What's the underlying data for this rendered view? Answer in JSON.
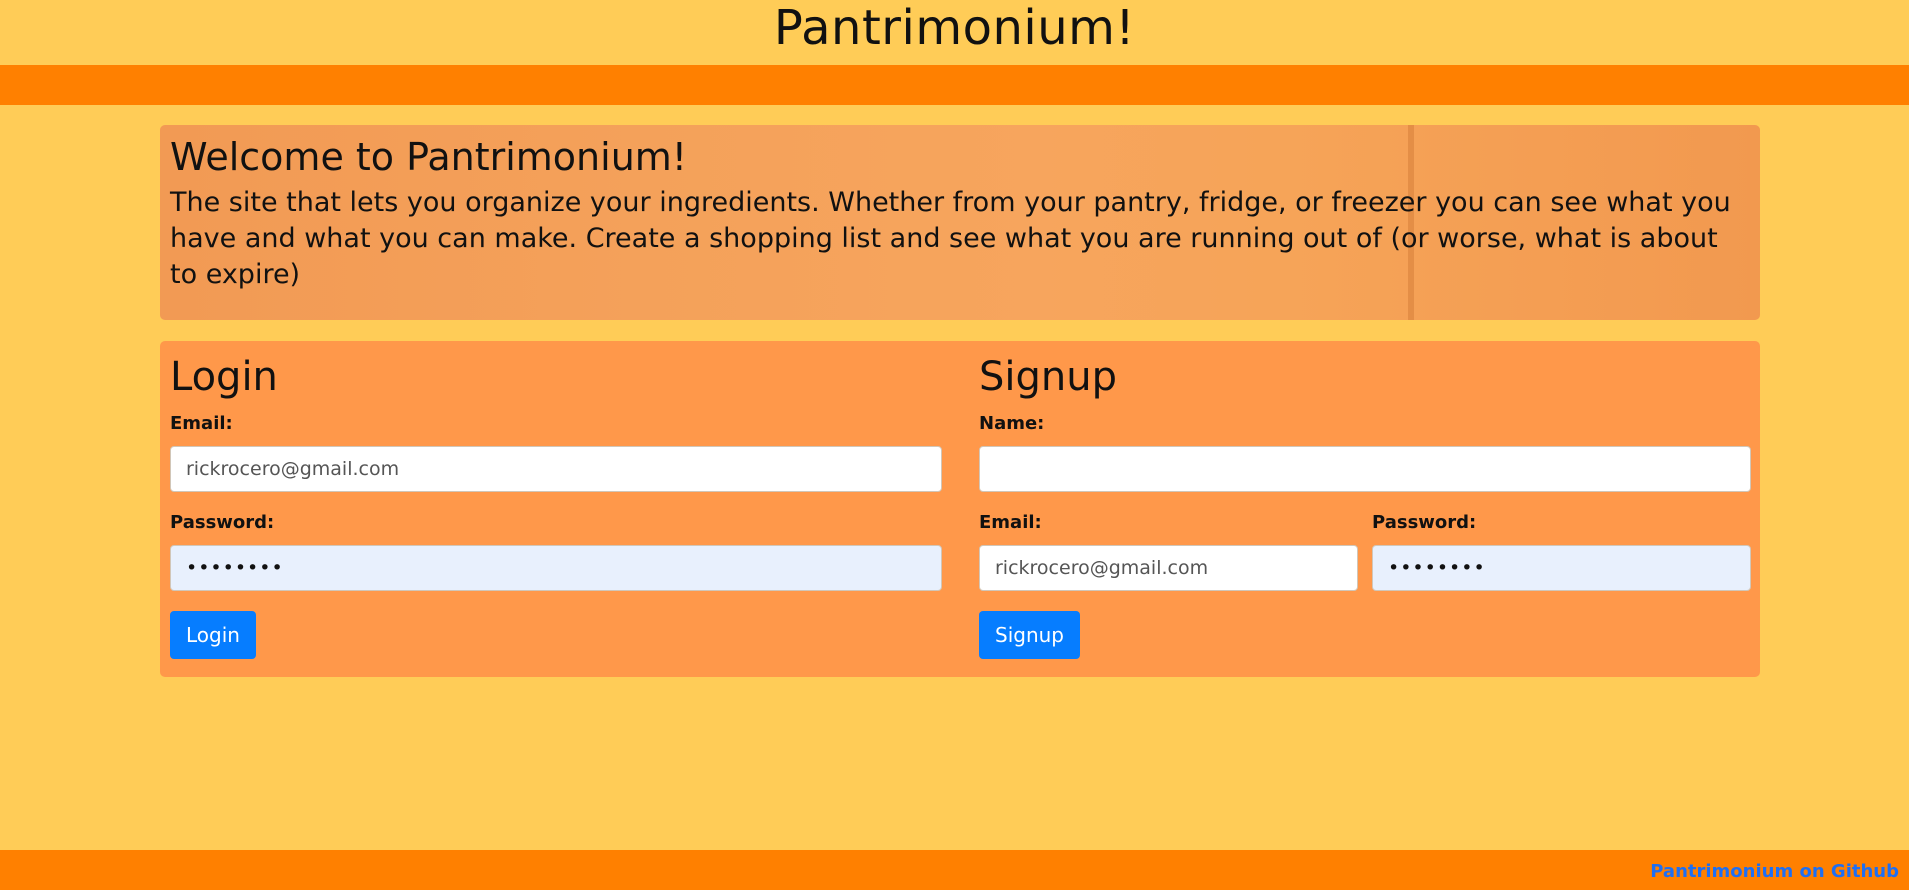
{
  "header": {
    "title": "Pantrimonium!"
  },
  "hero": {
    "heading": "Welcome to Pantrimonium!",
    "description": "The site that lets you organize your ingredients. Whether from your pantry, fridge, or freezer you can see what you have and what you can make. Create a shopping list and see what you are running out of (or worse, what is about to expire)"
  },
  "login": {
    "heading": "Login",
    "email_label": "Email:",
    "email_value": "rickrocero@gmail.com",
    "password_label": "Password:",
    "password_value": "••••••••",
    "button_label": "Login"
  },
  "signup": {
    "heading": "Signup",
    "name_label": "Name:",
    "name_value": "",
    "email_label": "Email:",
    "email_value": "rickrocero@gmail.com",
    "password_label": "Password:",
    "password_value": "••••••••",
    "button_label": "Signup"
  },
  "footer": {
    "link_label": "Pantrimonium on Github"
  },
  "colors": {
    "background": "#ffcc57",
    "band": "#ff8000",
    "panel": "#ff984a",
    "button": "#067dff",
    "link": "#1e6ff4"
  }
}
